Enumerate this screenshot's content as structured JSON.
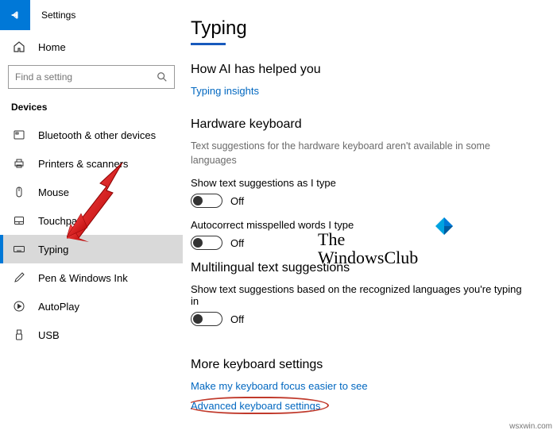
{
  "header": {
    "app_title": "Settings"
  },
  "sidebar": {
    "home_label": "Home",
    "search_placeholder": "Find a setting",
    "section_label": "Devices",
    "items": [
      {
        "label": "Bluetooth & other devices",
        "icon": "bluetooth"
      },
      {
        "label": "Printers & scanners",
        "icon": "printer"
      },
      {
        "label": "Mouse",
        "icon": "mouse"
      },
      {
        "label": "Touchpad",
        "icon": "touchpad"
      },
      {
        "label": "Typing",
        "icon": "keyboard",
        "active": true
      },
      {
        "label": "Pen & Windows Ink",
        "icon": "pen"
      },
      {
        "label": "AutoPlay",
        "icon": "autoplay"
      },
      {
        "label": "USB",
        "icon": "usb"
      }
    ]
  },
  "main": {
    "title": "Typing",
    "s1": {
      "heading": "How AI has helped you",
      "link": "Typing insights"
    },
    "s2": {
      "heading": "Hardware keyboard",
      "desc": "Text suggestions for the hardware keyboard aren't available in some languages",
      "opt1_label": "Show text suggestions as I type",
      "opt1_state": "Off",
      "opt2_label": "Autocorrect misspelled words I type",
      "opt2_state": "Off"
    },
    "s3": {
      "heading": "Multilingual text suggestions",
      "opt1_label": "Show text suggestions based on the recognized languages you're typing in",
      "opt1_state": "Off"
    },
    "s4": {
      "heading": "More keyboard settings",
      "link1": "Make my keyboard focus easier to see",
      "link2": "Advanced keyboard settings"
    }
  },
  "watermark": {
    "line1": "The",
    "line2": "WindowsClub",
    "url": "wsxwin.com"
  }
}
